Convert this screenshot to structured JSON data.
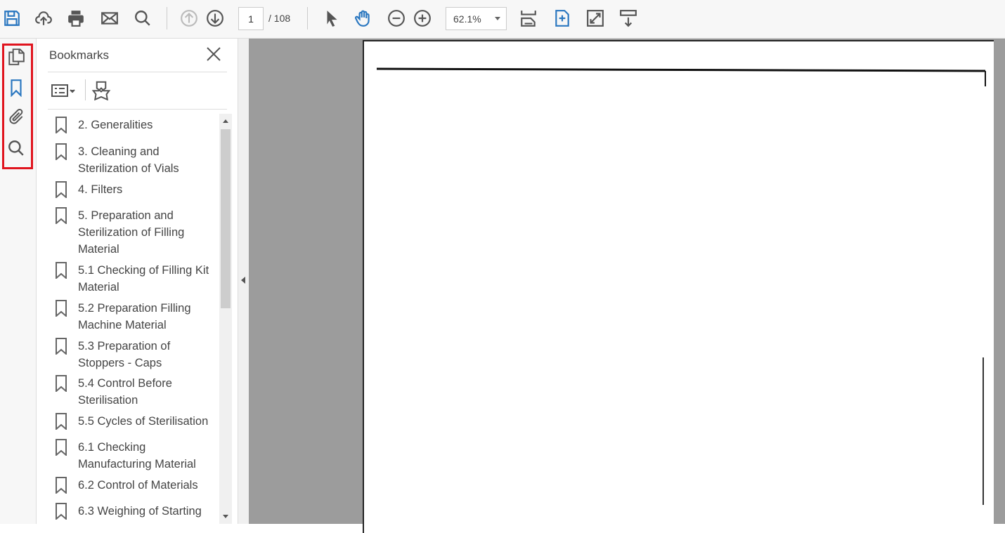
{
  "toolbar": {
    "page_current": "1",
    "page_total": "/ 108",
    "zoom": "62.1%"
  },
  "panel": {
    "title": "Bookmarks",
    "bookmarks": [
      "2. Generalities",
      "3. Cleaning and Sterilization of Vials",
      "4. Filters",
      "5. Preparation and Sterilization of Filling Material",
      "5.1 Checking of Filling Kit Material",
      "5.2 Preparation Filling Machine Material",
      "5.3 Preparation of Stoppers - Caps",
      "5.4 Control Before Sterilisation",
      "5.5 Cycles of Sterilisation",
      "6.1 Checking Manufacturing Material",
      "6.2 Control of Materials",
      "6.3 Weighing of Starting"
    ]
  },
  "colors": {
    "accent": "#2a77c0",
    "highlight": "#e0141e"
  }
}
